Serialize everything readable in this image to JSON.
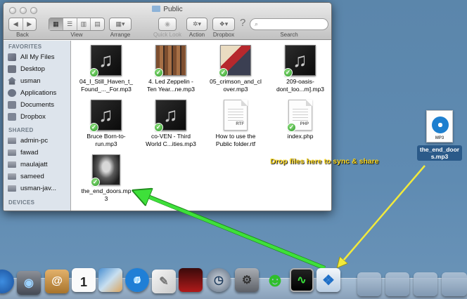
{
  "window": {
    "title": "Public",
    "toolbar": {
      "back_label": "Back",
      "view_label": "View",
      "arrange_label": "Arrange",
      "quicklook_label": "Quick Look",
      "action_label": "Action",
      "dropbox_label": "Dropbox",
      "search_label": "Search",
      "help_glyph": "?"
    },
    "sidebar": {
      "favorites_header": "FAVORITES",
      "favorites": [
        {
          "label": "All My Files",
          "icon": "all-files-icon"
        },
        {
          "label": "Desktop",
          "icon": "desktop-icon"
        },
        {
          "label": "usman",
          "icon": "home-icon"
        },
        {
          "label": "Applications",
          "icon": "applications-icon"
        },
        {
          "label": "Documents",
          "icon": "documents-icon"
        },
        {
          "label": "Dropbox",
          "icon": "dropbox-folder-icon"
        }
      ],
      "shared_header": "SHARED",
      "shared": [
        {
          "label": "admin-pc",
          "icon": "computer-icon"
        },
        {
          "label": "fawad",
          "icon": "computer-icon"
        },
        {
          "label": "maulajatt",
          "icon": "computer-icon"
        },
        {
          "label": "sameed",
          "icon": "computer-icon"
        },
        {
          "label": "usman-jav...",
          "icon": "computer-icon"
        }
      ],
      "devices_header": "DEVICES"
    },
    "files": [
      {
        "line1": "04_I_Still_Haven_t_",
        "line2": "Found_..._For.mp3",
        "kind": "mp3"
      },
      {
        "line1": "4. Led Zeppelin -",
        "line2": "Ten Year...ne.mp3",
        "kind": "zep"
      },
      {
        "line1": "05_crimson_and_cl",
        "line2": "over.mp3",
        "kind": "crimson"
      },
      {
        "line1": "209-oasis-",
        "line2": "dont_loo...m].mp3",
        "kind": "mp3"
      },
      {
        "line1": "Bruce  Born-to-",
        "line2": "run.mp3",
        "kind": "mp3"
      },
      {
        "line1": "co-VEN - Third",
        "line2": "World C...ities.mp3",
        "kind": "mp3"
      },
      {
        "line1": "How to use the",
        "line2": "Public folder.rtf",
        "kind": "doc",
        "tag": "RTF"
      },
      {
        "line1": "index.php",
        "line2": "",
        "kind": "doc",
        "tag": "PHP"
      },
      {
        "line1": "the_end_doors.mp",
        "line2": "3",
        "kind": "doors"
      }
    ]
  },
  "desktop_file": {
    "tag": "MP3",
    "line1": "the_end_door",
    "line2": "s.mp3"
  },
  "callout": "Drop files here to sync & share",
  "colors": {
    "desktop_bg": "#5f8bb2",
    "sync_check": "#2f9a2a",
    "callout_text": "#ffd91c",
    "green_arrow": "#3ee03a",
    "yellow_arrow": "#f2ea3c"
  }
}
